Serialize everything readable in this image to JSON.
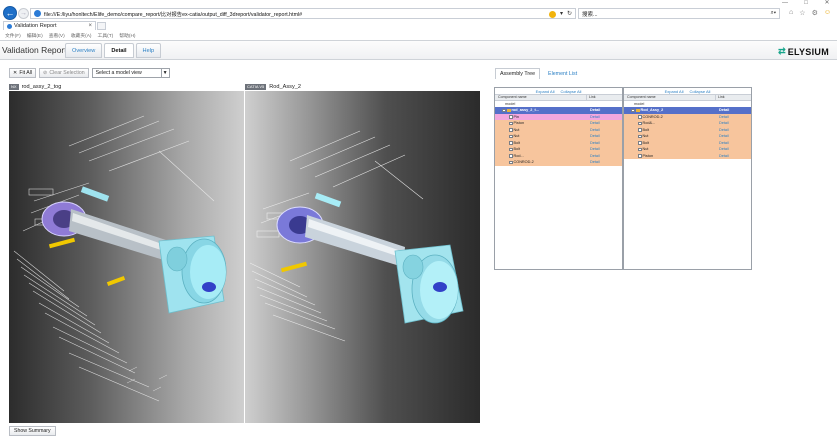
{
  "browser": {
    "url": "file:///E:/liyu/honltech/Elife_demo/compare_report/比对报告ex-catia/output_diff_3dreport/validator_report.html#",
    "search_placeholder": "搜索...",
    "tab_title": "Validation Report",
    "menu": [
      "文件(F)",
      "编辑(E)",
      "查看(V)",
      "收藏夹(A)",
      "工具(T)",
      "帮助(H)"
    ],
    "win_controls": [
      "—",
      "□",
      "✕"
    ]
  },
  "header": {
    "title": "Validation Report",
    "tabs": [
      {
        "label": "Overview",
        "active": false
      },
      {
        "label": "Detail",
        "active": true
      },
      {
        "label": "Help",
        "active": false
      }
    ],
    "logo_text": "ELYSIUM"
  },
  "toolbar": {
    "fit_all": "Fit All",
    "clear_selection": "Clear Selection",
    "model_view_select": "Select a model view"
  },
  "viewports": {
    "left": {
      "badge": "NX",
      "label": "rod_assy_2_tog"
    },
    "right": {
      "badge": "CATIA V5",
      "label": "Rod_Assy_2"
    }
  },
  "summary_button": "Show Summary",
  "right_panel": {
    "tabs": [
      {
        "label": "Assembly Tree",
        "active": true
      },
      {
        "label": "Element List",
        "active": false
      }
    ],
    "expand_all": "Expand All",
    "collapse_all": "Collapse All",
    "col_component": "Component name",
    "col_link": "Link",
    "model_label": "model",
    "left_tree": [
      {
        "name": "rod_assy_2_t...",
        "link": "Detail",
        "kind": "root"
      },
      {
        "name": "Pin",
        "link": "Detail",
        "kind": "pin"
      },
      {
        "name": "Piston",
        "link": "Detail",
        "kind": "diff"
      },
      {
        "name": "Nut",
        "link": "Detail",
        "kind": "diff"
      },
      {
        "name": "Nut",
        "link": "Detail",
        "kind": "diff"
      },
      {
        "name": "Bolt",
        "link": "Detail",
        "kind": "diff"
      },
      {
        "name": "Bolt",
        "link": "Detail",
        "kind": "diff"
      },
      {
        "name": "Rod...",
        "link": "Detail",
        "kind": "diff"
      },
      {
        "name": "CONROD-2",
        "link": "Detail",
        "kind": "diff"
      }
    ],
    "right_tree": [
      {
        "name": "Rod_Assy_2",
        "link": "Detail",
        "kind": "root"
      },
      {
        "name": "CONROD-2",
        "link": "Detail",
        "kind": "diff"
      },
      {
        "name": "Rod&...",
        "link": "Detail",
        "kind": "diff"
      },
      {
        "name": "Bolt",
        "link": "Detail",
        "kind": "diff"
      },
      {
        "name": "Nut",
        "link": "Detail",
        "kind": "diff"
      },
      {
        "name": "Bolt",
        "link": "Detail",
        "kind": "diff"
      },
      {
        "name": "Nut",
        "link": "Detail",
        "kind": "diff"
      },
      {
        "name": "Piston",
        "link": "Detail",
        "kind": "diff"
      }
    ]
  },
  "colors": {
    "accent_link": "#2a7fc4",
    "diff_row": "#f7c59d",
    "selected_row": "#5570c9",
    "pin_row": "#f3a7de",
    "part_cyan": "#9fe3ef"
  }
}
